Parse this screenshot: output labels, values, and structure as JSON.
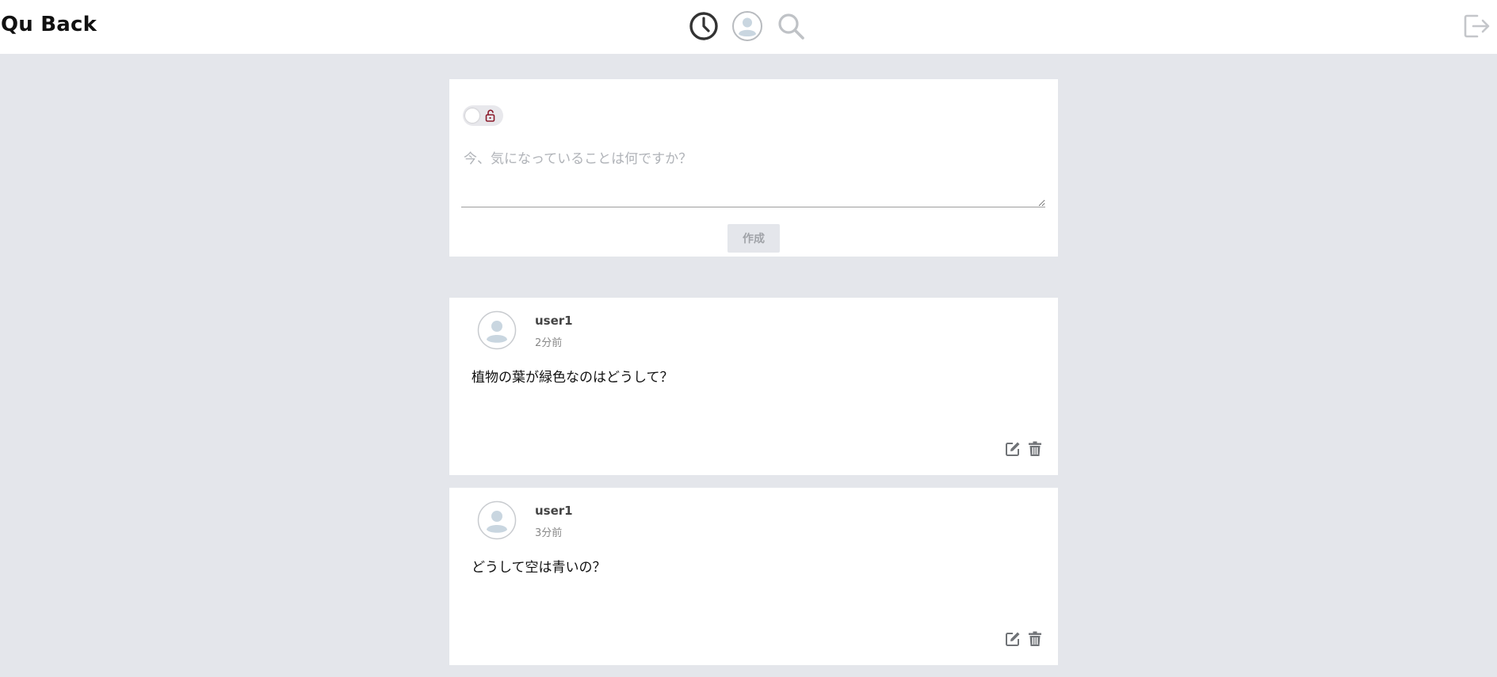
{
  "header": {
    "brand": "Qu Back",
    "icons": [
      "clock-icon",
      "user-circle-icon",
      "search-icon",
      "logout-icon"
    ]
  },
  "composer": {
    "toggle_icon": "lock-open-icon",
    "placeholder": "今、気になっていることは何ですか？",
    "value": "",
    "submit_label": "作成"
  },
  "posts": [
    {
      "username": "user1",
      "time": "2分前",
      "text": "植物の葉が緑色なのはどうして？",
      "actions": [
        "edit-icon",
        "trash-icon"
      ]
    },
    {
      "username": "user1",
      "time": "3分前",
      "text": "どうして空は青いの？",
      "actions": [
        "edit-icon",
        "trash-icon"
      ]
    }
  ],
  "colors": {
    "page_background": "#e4e6eb",
    "card_background": "#ffffff",
    "lock_accent": "#8b1a2b",
    "muted_icon": "#8a8d91"
  }
}
